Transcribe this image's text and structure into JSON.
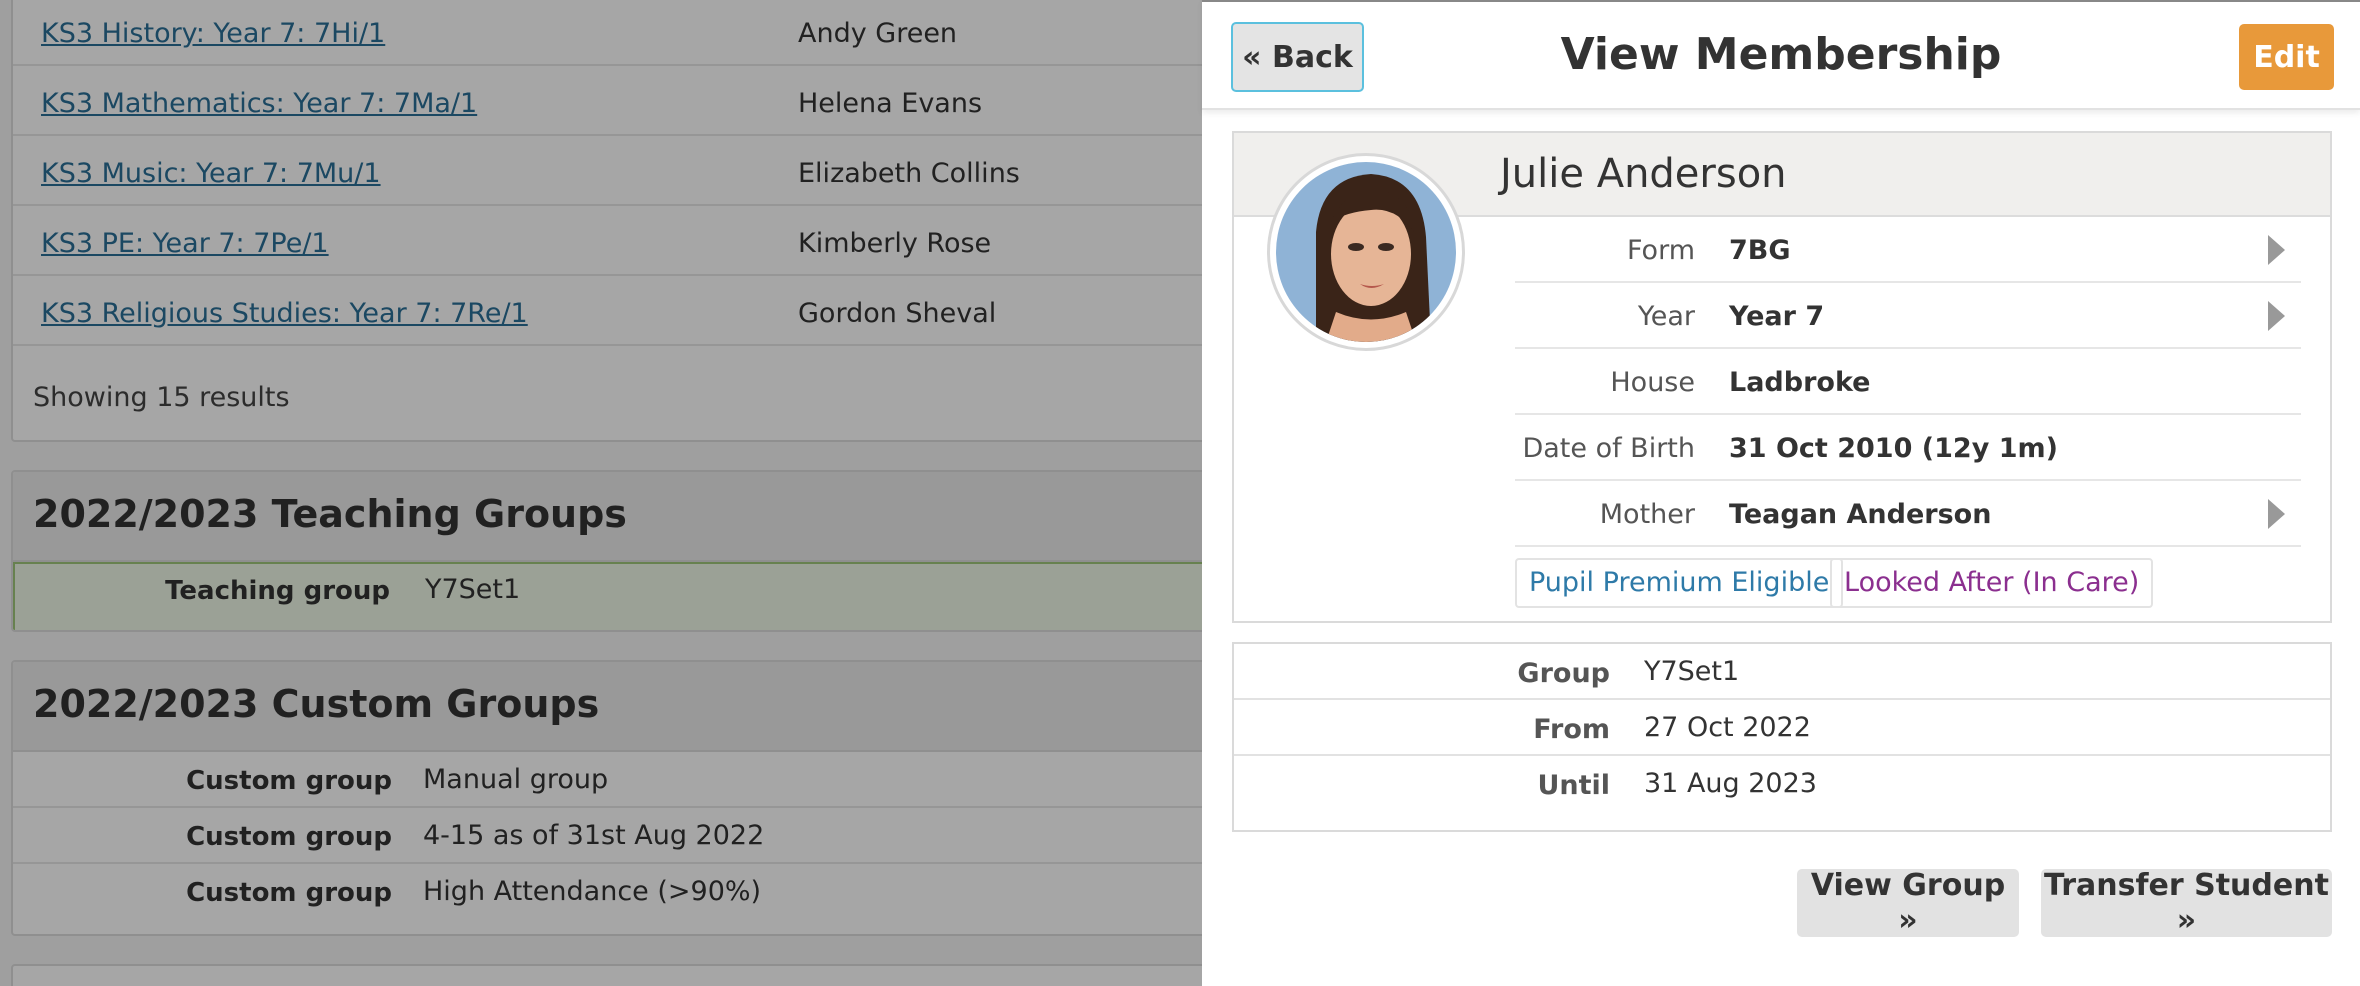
{
  "background": {
    "subjects": [
      {
        "subject": "KS3 History: Year 7: 7Hi/1",
        "teacher": "Andy Green"
      },
      {
        "subject": "KS3 Mathematics: Year 7: 7Ma/1",
        "teacher": "Helena Evans"
      },
      {
        "subject": "KS3 Music: Year 7: 7Mu/1",
        "teacher": "Elizabeth Collins"
      },
      {
        "subject": "KS3 PE: Year 7: 7Pe/1",
        "teacher": "Kimberly Rose"
      },
      {
        "subject": "KS3 Religious Studies: Year 7: 7Re/1",
        "teacher": "Gordon Sheval"
      }
    ],
    "showing": "Showing 15 results",
    "teaching_groups": {
      "title": "2022/2023 Teaching Groups",
      "rows": [
        {
          "key": "Teaching group",
          "value": "Y7Set1"
        }
      ]
    },
    "custom_groups": {
      "title": "2022/2023 Custom Groups",
      "rows": [
        {
          "key": "Custom group",
          "value": "Manual group"
        },
        {
          "key": "Custom group",
          "value": "4-15 as of 31st Aug 2022"
        },
        {
          "key": "Custom group",
          "value": "High Attendance (>90%)"
        }
      ]
    }
  },
  "panel": {
    "title": "View Membership",
    "back_label": "« Back",
    "edit_label": "Edit",
    "student": {
      "name": "Julie Anderson",
      "details": [
        {
          "label": "Form",
          "value": "7BG"
        },
        {
          "label": "Year",
          "value": "Year 7"
        },
        {
          "label": "House",
          "value": "Ladbroke"
        },
        {
          "label": "Date of Birth",
          "value": "31 Oct 2010 (12y 1m)"
        },
        {
          "label": "Mother",
          "value": "Teagan Anderson"
        }
      ],
      "tags": [
        "Pupil Premium Eligible",
        "Looked After (In Care)"
      ]
    },
    "membership": [
      {
        "label": "Group",
        "value": "Y7Set1"
      },
      {
        "label": "From",
        "value": "27 Oct 2022"
      },
      {
        "label": "Until",
        "value": "31 Aug 2023"
      }
    ],
    "view_group_label": "View Group »",
    "transfer_label": "Transfer Student »"
  },
  "colors": {
    "edit_button": "#e8993a",
    "back_border": "#5bc0de",
    "link": "#2a6f97",
    "tag_pupil_premium": "#2e7aa8",
    "tag_looked_after": "#8b2f8f",
    "teaching_group_highlight": "#eef7e6"
  }
}
